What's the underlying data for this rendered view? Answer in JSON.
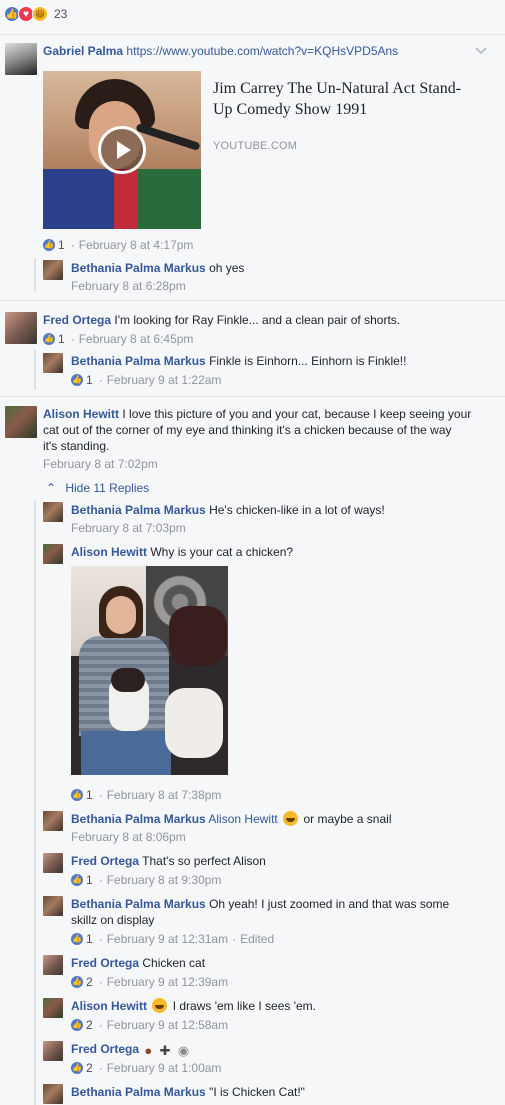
{
  "reactions": {
    "count": "23"
  },
  "post": {
    "author": "Gabriel Palma",
    "url": "https://www.youtube.com/watch?v=KQHsVPD5Ans",
    "video_title": "Jim Carrey The Un-Natural Act Stand-Up Comedy Show 1991",
    "video_source": "YOUTUBE.COM",
    "likes": "1",
    "time": "February 8 at 4:17pm",
    "reply": {
      "author": "Bethania Palma Markus",
      "text": "oh yes",
      "time": "February 8 at 6:28pm"
    }
  },
  "fred": {
    "author": "Fred Ortega",
    "text": "I'm looking for Ray Finkle... and a clean pair of shorts.",
    "likes": "1",
    "time": "February 8 at 6:45pm",
    "reply": {
      "author": "Bethania Palma Markus",
      "text": "Finkle is Einhorn... Einhorn is Finkle!!",
      "likes": "1",
      "time": "February 9 at 1:22am"
    }
  },
  "alison": {
    "author": "Alison Hewitt",
    "text_line1": "I love this picture of you and your cat, because I keep seeing your",
    "text_line2": "cat out of the corner of my eye and thinking it's a chicken because of the way",
    "text_line3": "it's standing.",
    "time": "February 8 at 7:02pm",
    "hide_replies": "Hide 11 Replies"
  },
  "replies": [
    {
      "author": "Bethania Palma Markus",
      "text": "He's chicken-like in a lot of ways!",
      "time": "February 8 at 7:03pm"
    },
    {
      "author": "Alison Hewitt",
      "text": "Why is your cat a chicken?",
      "likes": "1",
      "time": "February 8 at 7:38pm"
    },
    {
      "author": "Bethania Palma Markus",
      "mention": "Alison Hewitt",
      "text": "or maybe a snail",
      "time": "February 8 at 8:06pm"
    },
    {
      "author": "Fred Ortega",
      "text": "That's so perfect Alison",
      "likes": "1",
      "time": "February 8 at 9:30pm"
    },
    {
      "author": "Bethania Palma Markus",
      "text_line1": "Oh yeah! I just zoomed in and that was some",
      "text_line2": "skillz on display",
      "likes": "1",
      "time": "February 9 at 12:31am",
      "edited": "Edited"
    },
    {
      "author": "Fred Ortega",
      "text": "Chicken cat",
      "likes": "2",
      "time": "February 9 at 12:39am"
    },
    {
      "author": "Alison Hewitt",
      "text": "I draws 'em like I sees 'em.",
      "likes": "2",
      "time": "February 9 at 12:58am"
    },
    {
      "author": "Fred Ortega",
      "likes": "2",
      "time": "February 9 at 1:00am"
    },
    {
      "author": "Bethania Palma Markus",
      "text": "\"I is Chicken Cat!\""
    }
  ],
  "icons": {
    "like": "like-icon",
    "love": "love-icon",
    "haha": "haha-icon"
  },
  "colors": {
    "link_blue": "#365899",
    "meta_gray": "#90949c",
    "like_blue": "#4d79c6"
  }
}
